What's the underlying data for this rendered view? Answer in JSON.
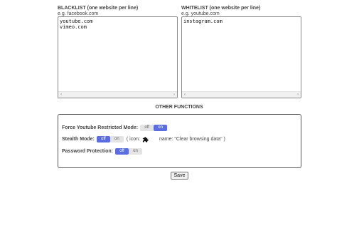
{
  "blacklist": {
    "title": "BLACKLIST (one website per line)",
    "example": "e.g. facebook.com",
    "value": "youtube.com\nvimeo.com"
  },
  "whitelist": {
    "title": "WHITELIST (one website per line)",
    "example": "e.g. youtube.com",
    "value": "instagram.com"
  },
  "scroll_arrows": {
    "left": "‹",
    "right": "›"
  },
  "other_functions": {
    "title": "OTHER FUNCTIONS",
    "restricted_mode": {
      "label": "Force Youtube Restricted Mode:",
      "off": "off",
      "on": "on",
      "selected": "on"
    },
    "stealth_mode": {
      "label": "Stealth Mode:",
      "off": "off",
      "on": "on",
      "selected": "off",
      "icon_prefix": "( icon:",
      "icon": "puzzle-piece-icon",
      "name_text": "name: \"Clear browsing data\" )"
    },
    "password_protection": {
      "label": "Password Protection:",
      "off": "off",
      "on": "on",
      "selected": "off"
    }
  },
  "save_button": {
    "label": "Save"
  },
  "colors": {
    "toggle_active": "#5b6ee1",
    "toggle_inactive": "#e4e4e4"
  }
}
